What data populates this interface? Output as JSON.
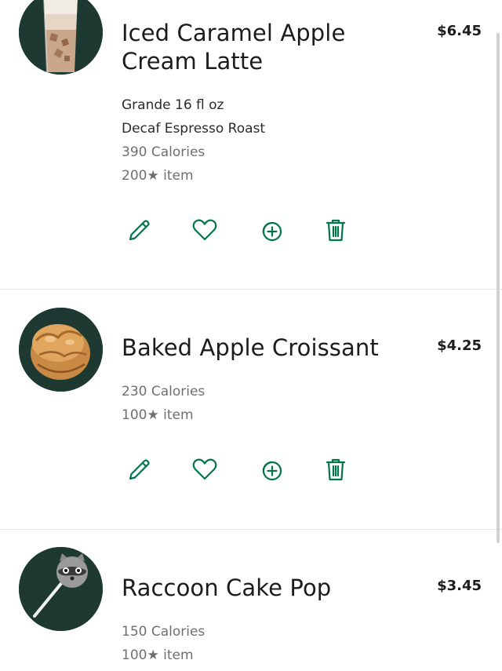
{
  "colors": {
    "brand_green": "#00754a",
    "thumb_bg": "#1e3932"
  },
  "items": [
    {
      "name": "Iced Caramel Apple Cream Latte",
      "price": "$6.45",
      "size": "Grande 16 fl oz",
      "option": "Decaf Espresso Roast",
      "calories": "390 Calories",
      "stars": "200★ item",
      "actions": [
        "pencil-icon",
        "heart-icon",
        "add-circle-icon",
        "trash-icon"
      ]
    },
    {
      "name": "Baked Apple Croissant",
      "price": "$4.25",
      "calories": "230 Calories",
      "stars": "100★ item",
      "actions": [
        "pencil-icon",
        "heart-icon",
        "add-circle-icon",
        "trash-icon"
      ]
    },
    {
      "name": "Raccoon Cake Pop",
      "price": "$3.45",
      "calories": "150 Calories",
      "stars": "100★ item"
    }
  ]
}
